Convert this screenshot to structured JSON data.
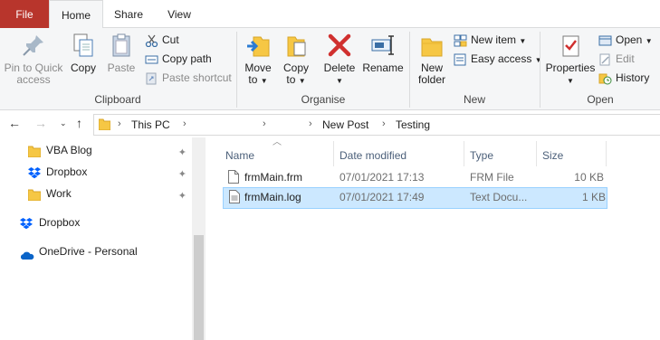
{
  "tabs": {
    "file": "File",
    "home": "Home",
    "share": "Share",
    "view": "View"
  },
  "clipboard": {
    "label": "Clipboard",
    "pin": [
      "Pin to Quick",
      "access"
    ],
    "copy": "Copy",
    "paste": "Paste",
    "cut": "Cut",
    "copy_path": "Copy path",
    "paste_shortcut": "Paste shortcut"
  },
  "organise": {
    "label": "Organise",
    "move_to": [
      "Move",
      "to"
    ],
    "copy_to": [
      "Copy",
      "to"
    ],
    "delete": "Delete",
    "rename": "Rename"
  },
  "new": {
    "label": "New",
    "new_folder": [
      "New",
      "folder"
    ],
    "new_item": "New item",
    "easy_access": "Easy access"
  },
  "open": {
    "label": "Open",
    "properties": "Properties",
    "open": "Open",
    "edit": "Edit",
    "history": "History"
  },
  "address": {
    "crumbs": [
      "This PC",
      "New Post",
      "Testing"
    ]
  },
  "nav_pane": [
    {
      "label": "VBA Blog",
      "icon": "folder-icon",
      "pinned": true
    },
    {
      "label": "Dropbox",
      "icon": "dropbox-icon",
      "pinned": true
    },
    {
      "label": "Work",
      "icon": "folder-icon",
      "pinned": true
    },
    {
      "label": "Dropbox",
      "icon": "dropbox-icon",
      "pinned": false
    },
    {
      "label": "OneDrive - Personal",
      "icon": "onedrive-icon",
      "pinned": false
    }
  ],
  "columns": {
    "name": "Name",
    "date": "Date modified",
    "type": "Type",
    "size": "Size"
  },
  "files": [
    {
      "name": "frmMain.frm",
      "date": "07/01/2021 17:13",
      "type": "FRM File",
      "size": "10 KB",
      "selected": false
    },
    {
      "name": "frmMain.log",
      "date": "07/01/2021 17:49",
      "type": "Text Docu...",
      "size": "1 KB",
      "selected": true
    }
  ],
  "colors": {
    "file_tab": "#b8352c",
    "selection": "#cce8ff",
    "selection_border": "#99d1ff",
    "folder": "#f6c744"
  }
}
